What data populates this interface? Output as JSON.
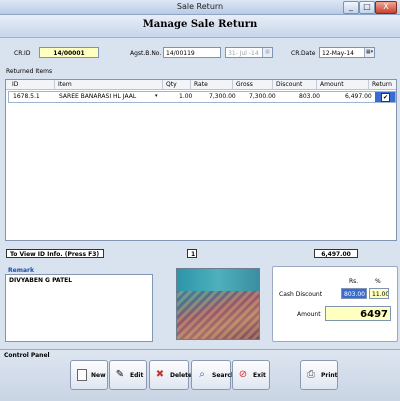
{
  "window": {
    "title": "Sale Return",
    "minimize": "_",
    "maximize": "□",
    "close": "X"
  },
  "header": {
    "title": "Manage Sale Return"
  },
  "form": {
    "cr_id_label": "CR.ID",
    "cr_id_value": "14/00001",
    "agst_bno_label": "Agst.B.No.",
    "agst_bno_value": "14/00119",
    "agst_date_value": "31- Jul -14",
    "cr_date_label": "CR.Date",
    "cr_date_value": "12-May-14"
  },
  "returned_items": {
    "label": "Returned Items",
    "columns": [
      "ID",
      "Item",
      "Qty",
      "Rate",
      "Gross",
      "Discount",
      "Amount",
      "Return"
    ],
    "rows": [
      {
        "id": "1678.5.1",
        "item": "SAREE BANARASI HL JAAL",
        "qty": "1.00",
        "rate": "7,300.00",
        "gross": "7,300.00",
        "discount": "803.00",
        "amount": "6,497.00",
        "return": true
      }
    ]
  },
  "footer_info": {
    "hint": "To View ID Info. (Press F3)",
    "count": "1",
    "total": "6,497.00"
  },
  "remark": {
    "label": "Remark",
    "text": "DIVYABEN G PATEL"
  },
  "discount": {
    "rs_label": "Rs.",
    "pct_label": "%",
    "cash_discount_label": "Cash Discount",
    "cash_discount_rs": "803.00",
    "cash_discount_pct": "11.00",
    "amount_label": "Amount",
    "amount_value": "6497"
  },
  "control_panel": {
    "label": "Control Panel",
    "buttons": [
      "New",
      "Edit",
      "Delete",
      "Search",
      "Exit",
      "Print"
    ]
  }
}
